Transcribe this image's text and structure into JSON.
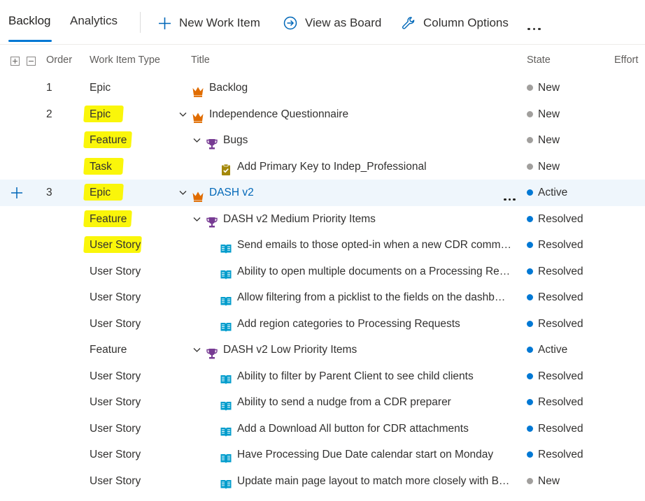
{
  "tabs": [
    {
      "label": "Backlog",
      "active": true
    },
    {
      "label": "Analytics",
      "active": false
    }
  ],
  "toolbar": {
    "new_work_item": "New Work Item",
    "view_as_board": "View as Board",
    "column_options": "Column Options",
    "more_icon": "more-horizontal-icon"
  },
  "columns": {
    "order": "Order",
    "work_item_type": "Work Item Type",
    "title": "Title",
    "state": "State",
    "effort": "Effort"
  },
  "colors": {
    "accent": "#0078d4",
    "highlight": "#faf60a",
    "state_new": "#a19f9d",
    "state_active": "#0078d4",
    "state_resolved": "#0078d4",
    "epic_icon": "#e06c00",
    "feature_icon": "#773b93",
    "story_icon": "#009ccc",
    "task_icon": "#a4880a",
    "selected_row": "#eff6fc"
  },
  "rows": [
    {
      "order": "1",
      "type": "Epic",
      "highlighted": false,
      "indent": 0,
      "expand": false,
      "icon": "crown-icon",
      "title": "Backlog",
      "state": "New"
    },
    {
      "order": "2",
      "type": "Epic",
      "highlighted": true,
      "indent": 0,
      "expand": true,
      "icon": "crown-icon",
      "title": "Independence Questionnaire",
      "state": "New"
    },
    {
      "order": "",
      "type": "Feature",
      "highlighted": true,
      "indent": 1,
      "expand": true,
      "icon": "trophy-icon",
      "title": "Bugs",
      "state": "New"
    },
    {
      "order": "",
      "type": "Task",
      "highlighted": true,
      "indent": 2,
      "expand": false,
      "icon": "clipboard-check-icon",
      "title": "Add Primary Key to Indep_Professional",
      "state": "New"
    },
    {
      "order": "3",
      "type": "Epic",
      "highlighted": true,
      "indent": 0,
      "expand": true,
      "icon": "crown-icon",
      "title": "DASH v2",
      "state": "Active",
      "selected": true
    },
    {
      "order": "",
      "type": "Feature",
      "highlighted": true,
      "indent": 1,
      "expand": true,
      "icon": "trophy-icon",
      "title": "DASH v2 Medium Priority Items",
      "state": "Resolved"
    },
    {
      "order": "",
      "type": "User Story",
      "highlighted": true,
      "indent": 2,
      "expand": false,
      "icon": "book-icon",
      "title": "Send emails to those opted-in when a new CDR comm…",
      "state": "Resolved"
    },
    {
      "order": "",
      "type": "User Story",
      "highlighted": false,
      "indent": 2,
      "expand": false,
      "icon": "book-icon",
      "title": "Ability to open multiple documents on a Processing Re…",
      "state": "Resolved"
    },
    {
      "order": "",
      "type": "User Story",
      "highlighted": false,
      "indent": 2,
      "expand": false,
      "icon": "book-icon",
      "title": "Allow filtering from a picklist to the fields on the dashb…",
      "state": "Resolved"
    },
    {
      "order": "",
      "type": "User Story",
      "highlighted": false,
      "indent": 2,
      "expand": false,
      "icon": "book-icon",
      "title": "Add region categories to Processing Requests",
      "state": "Resolved"
    },
    {
      "order": "",
      "type": "Feature",
      "highlighted": false,
      "indent": 1,
      "expand": true,
      "icon": "trophy-icon",
      "title": "DASH v2 Low Priority Items",
      "state": "Active"
    },
    {
      "order": "",
      "type": "User Story",
      "highlighted": false,
      "indent": 2,
      "expand": false,
      "icon": "book-icon",
      "title": "Ability to filter by Parent Client to see child clients",
      "state": "Resolved"
    },
    {
      "order": "",
      "type": "User Story",
      "highlighted": false,
      "indent": 2,
      "expand": false,
      "icon": "book-icon",
      "title": "Ability to send a nudge from a CDR preparer",
      "state": "Resolved"
    },
    {
      "order": "",
      "type": "User Story",
      "highlighted": false,
      "indent": 2,
      "expand": false,
      "icon": "book-icon",
      "title": "Add a Download All button for CDR attachments",
      "state": "Resolved"
    },
    {
      "order": "",
      "type": "User Story",
      "highlighted": false,
      "indent": 2,
      "expand": false,
      "icon": "book-icon",
      "title": "Have Processing Due Date calendar start on Monday",
      "state": "Resolved"
    },
    {
      "order": "",
      "type": "User Story",
      "highlighted": false,
      "indent": 2,
      "expand": false,
      "icon": "book-icon",
      "title": "Update main page layout to match more closely with B…",
      "state": "New"
    }
  ]
}
